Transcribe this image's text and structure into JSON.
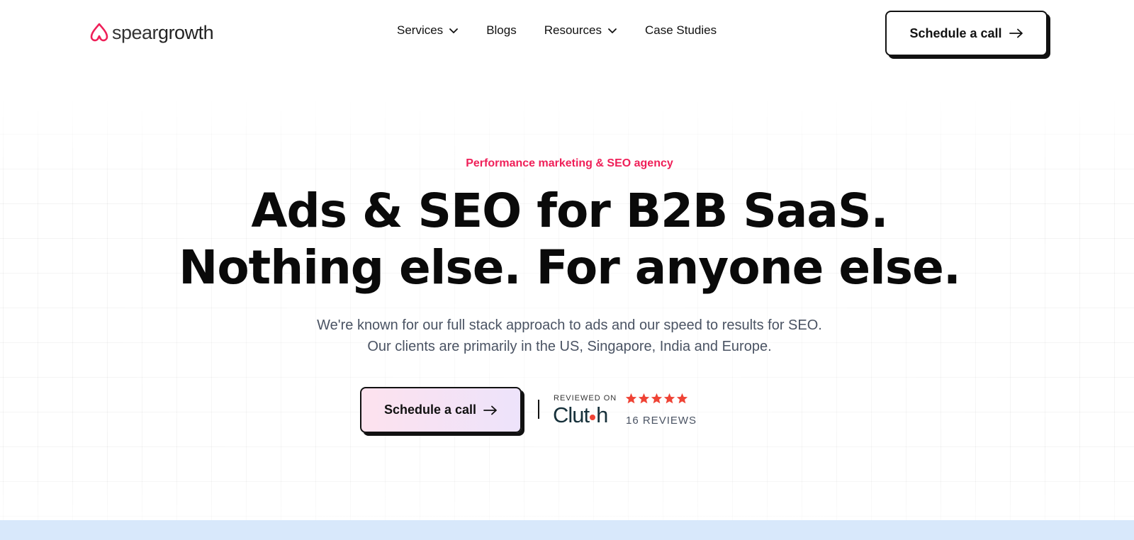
{
  "header": {
    "logo": {
      "light": "spear",
      "bold": "growth"
    },
    "nav": [
      {
        "label": "Services",
        "has_dropdown": true,
        "icon": "chevron-down-icon"
      },
      {
        "label": "Blogs",
        "has_dropdown": false
      },
      {
        "label": "Resources",
        "has_dropdown": true,
        "icon": "chevron-down-icon"
      },
      {
        "label": "Case Studies",
        "has_dropdown": false
      }
    ],
    "cta_label": "Schedule a call",
    "cta_icon": "arrow-right-icon"
  },
  "hero": {
    "eyebrow": "Performance marketing & SEO agency",
    "headline_line1": "Ads & SEO for B2B SaaS.",
    "headline_line2": "Nothing else. For anyone else.",
    "sub_line1": "We're known for our full stack approach to ads and our speed to results for SEO.",
    "sub_line2": "Our clients are primarily in the US, Singapore, India and Europe.",
    "cta_label": "Schedule a call",
    "cta_icon": "arrow-right-icon"
  },
  "clutch": {
    "reviewed_on": "REVIEWED ON",
    "brand_before_dot": "Clut",
    "brand_after_dot": "h",
    "rating": 5,
    "rating_max": 5,
    "review_count": "16 REVIEWS"
  },
  "colors": {
    "accent": "#ef1f58",
    "star": "#ef4335",
    "clutch_brand": "#17313b",
    "band": "#d8e8fb"
  }
}
